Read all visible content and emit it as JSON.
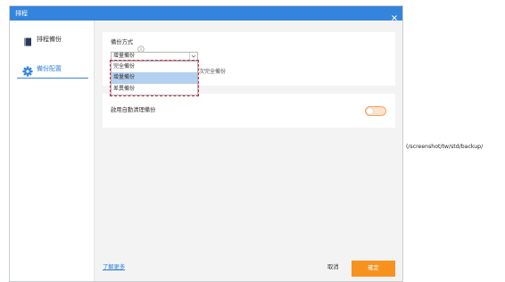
{
  "window": {
    "title": "排程",
    "close_icon": "close-icon"
  },
  "sidebar": {
    "active_index": 1,
    "items": [
      {
        "label": "排程備份",
        "icon": "book-icon"
      },
      {
        "label": "備份配置",
        "icon": "gear-icon"
      }
    ]
  },
  "backup_method": {
    "label": "備份方式",
    "info_icon": "info-icon",
    "selected": "增量備份",
    "options": [
      "完全備份",
      "增量備份",
      "差異備份"
    ],
    "highlighted_index": 1,
    "hint_partial": "次完全備份"
  },
  "auto_cleanup": {
    "label": "啟用自動清理備份",
    "enabled": false
  },
  "footer": {
    "learn_more": "了解更多",
    "cancel": "取消",
    "confirm": "確定"
  },
  "side_text": "(/screenshot/tw/std/backup/",
  "colors": {
    "accent": "#3584dc",
    "confirm_button": "#f8921e",
    "option_highlight": "#b4d0f0",
    "annotation": "#d9232e",
    "toggle_border": "#f4a460"
  }
}
